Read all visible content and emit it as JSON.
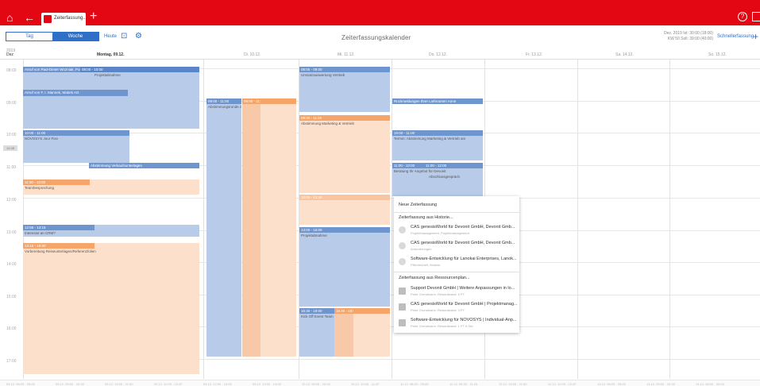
{
  "header": {
    "tab_label": "Zeiterfassung...",
    "icons": [
      "home-icon",
      "back-icon",
      "add-tab-icon",
      "help-icon",
      "logout-icon"
    ]
  },
  "toolbar": {
    "tag": "Tag",
    "woche": "Woche",
    "heute": "Heute",
    "title": "Zeiterfassungskalender",
    "date_line1": "Dez. 2019  Ist: 30:00   (18:00)",
    "date_line2": "KW 50  Soll: 39:00   (40:00)",
    "schnell": "Schnellerfassung"
  },
  "calendar": {
    "year": "2019",
    "dez": "Dez",
    "days": [
      {
        "label": "Montag, 09.12."
      },
      {
        "label": "Di. 10.12."
      },
      {
        "label": "Mi. 11.12."
      },
      {
        "label": "Do. 12.12."
      },
      {
        "label": "Fr. 13.12."
      },
      {
        "label": "Sa. 14.12."
      },
      {
        "label": "So. 15.12."
      }
    ],
    "hours": [
      "08:00",
      "09:00",
      "10:00",
      "11:00",
      "12:00",
      "13:00",
      "14:00",
      "15:00",
      "16:00",
      "17:00"
    ],
    "now": "10:35"
  },
  "events": {
    "mo1_bar": "Anruf von Paul-Dieter Wozniak, Portfolio",
    "mo1b_bar": "08:00 - 10:00",
    "mo1_txt": "Projektabnahme",
    "mo2_bar": "Anruf von F. I. Mannek, Mabek AG",
    "mo3_bar": "10:00 - 11:00",
    "mo3_txt": "NOVOSYS Jour Fixe",
    "mo4_bar": "Abstimmung Verkaufsunterlagen",
    "mo5_bar": "11:30 - 12:00",
    "mo5_txt": "Teambesprechung",
    "mo6_bar": "12:55 - 13:15",
    "mo6_txt": "Interesse an CRM?",
    "mo7_bar": "13:15 - 18:00",
    "mo7_txt": "Vorbereitung Reiseunterlagen/Referenzfolien",
    "di1_bar": "09:00 - 11:00",
    "di1_txt": "Abstimmungsrunde zum Marketingplan CRM Ko",
    "di1b_bar": "09:00 - 11:00",
    "mi1_bar": "08:00 - 09:00",
    "mi1_txt": "Umsatzauswertung Vertrieb",
    "mi2_bar": "09:30 - 11:20",
    "mi2_txt": "Abstimmung Marketing & Vertrieb",
    "mi3_bar": "12:00 - 12:30",
    "mi4_bar": "13:00 - 15:00",
    "mi4_txt": "Projektabnahme",
    "mi5_bar": "15:30 - 18:00",
    "mi5b_bar": "15:30 - 18:00",
    "mi5_txt": "Kick Off Event Team Just for Fun - Board Team",
    "do1_bar": "Rückmeldungen Ihrer Lieferanten Anne",
    "do2_bar": "10:00 - 11:00",
    "do2_txt": "Termin: Abstimmung Marketing & Vertrieb am",
    "do3_bar": "11:00 - 12:00",
    "do3b_bar": "11:00 - 12:00",
    "do3_txt": "Beratung Ihr Angebot für Devonit",
    "do3_txt2": "Abschlussgespräch"
  },
  "context_menu": {
    "new": "Neue Zeiterfassung",
    "from_history": "Zeiterfassung aus Historie...",
    "history_items": [
      {
        "title": "CAS genesisWorld für Devonit GmbH, Devonit Gmb...",
        "sub": "Projektmanagement, Projektmanagement"
      },
      {
        "title": "CAS genesisWorld für Devonit GmbH, Devonit Gmb...",
        "sub": "Anforderungen"
      },
      {
        "title": "Software-Entwicklung für Lanokai Enterprises, Lanok...",
        "sub": "Pflichtenheft, Module"
      }
    ],
    "from_resource": "Zeiterfassung aus Ressourcenplan...",
    "resource_items": [
      {
        "title": "Support Devonit GmbH | Weitere Anpassungen in lo...",
        "sub": "Peter Grundmann, Restaufwand: 5 PT"
      },
      {
        "title": "CAS genesisWorld für Devonit GmbH | Projektmanag...",
        "sub": "Peter Grundmann, Restaufwand: 3 PT"
      },
      {
        "title": "Software-Entwicklung für NOVOSYS | Individual-Anp...",
        "sub": "Peter Grundmann, Restaufwand: 1 PT 6 Std"
      }
    ]
  },
  "bottom_ticks": [
    "09.12. 08:00 - 09:00",
    "09.12. 09:00 - 10:00",
    "09.12. 10:00 - 11:00",
    "09.12. 11:00 - 12:00",
    "09.12. 12:00 - 13:00",
    "09.12. 13:00 - 14:00",
    "10.12. 09:00 - 10:00",
    "10.12. 10:00 - 11:00",
    "11.12. 08:00 - 09:00",
    "11.12. 09:30 - 11:20",
    "12.12. 10:00 - 11:00",
    "12.12. 11:00 - 12:00",
    "13.12. 08:00 - 09:00",
    "13.12. 09:00 - 10:00",
    "14.12. 08:00 - 09:00"
  ]
}
